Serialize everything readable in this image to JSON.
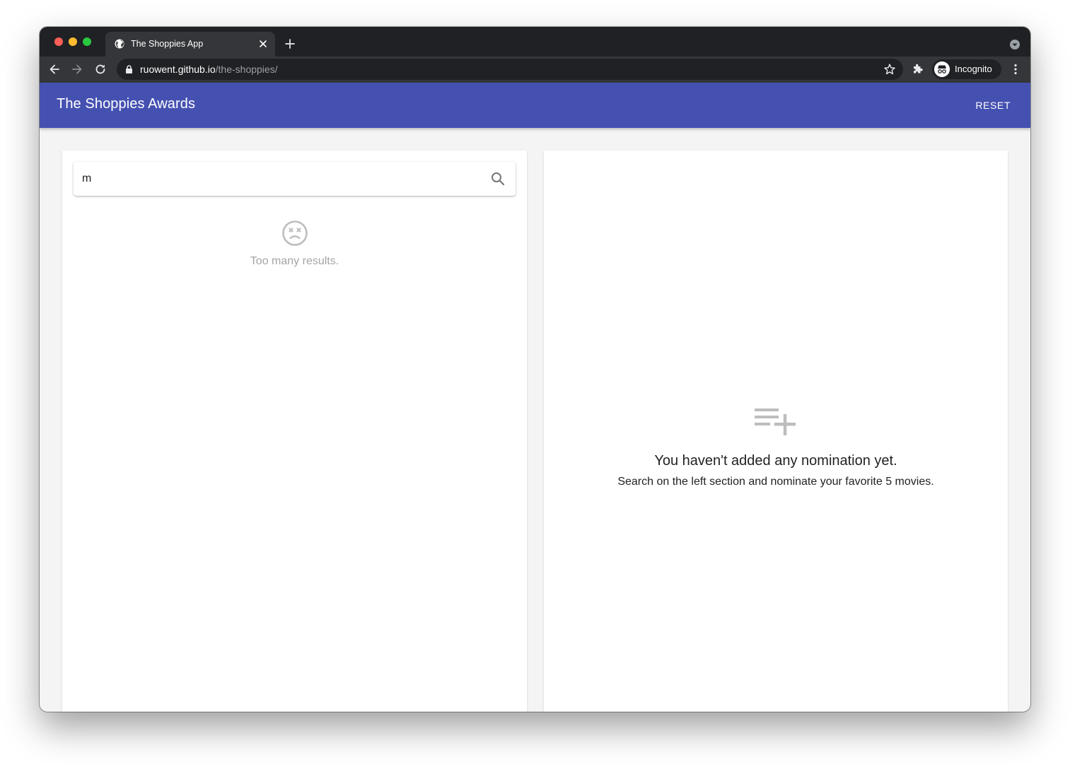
{
  "browser": {
    "tab_title": "The Shoppies App",
    "url_host": "ruowent.github.io",
    "url_path": "/the-shoppies/",
    "profile_label": "Incognito"
  },
  "app": {
    "title": "The Shoppies Awards",
    "reset_label": "RESET",
    "accent_color": "#4551b1"
  },
  "search": {
    "value": "m",
    "status_message": "Too many results."
  },
  "nominations": {
    "empty_title": "You haven't added any nomination yet.",
    "empty_subtitle": "Search on the left section and nominate your favorite 5 movies."
  },
  "icons": {
    "search": "search-icon",
    "status": "sad-face-icon",
    "empty": "playlist-add-icon"
  }
}
